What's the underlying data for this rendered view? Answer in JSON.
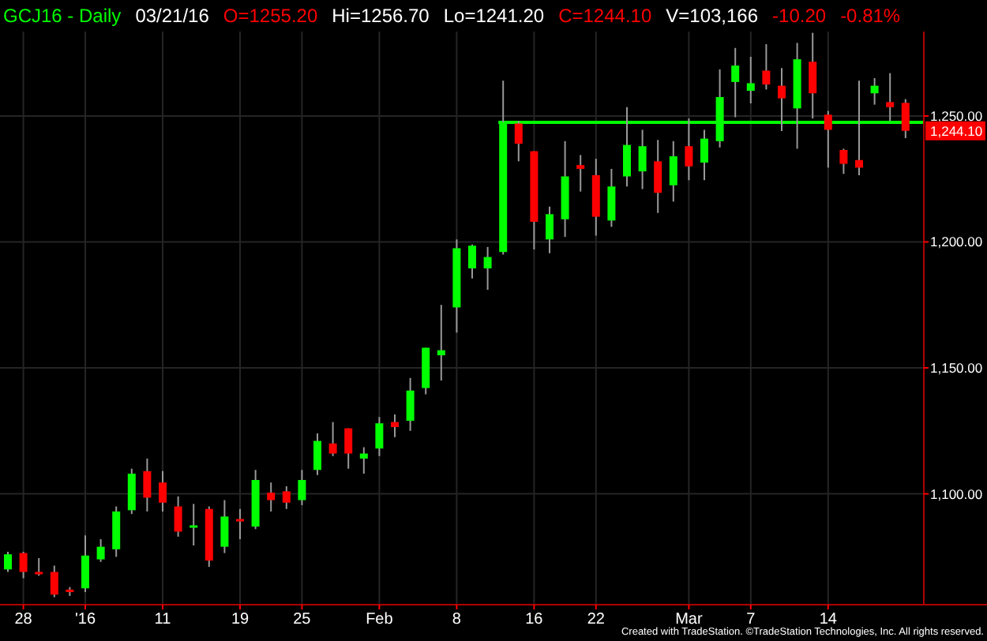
{
  "header": {
    "items": [
      {
        "text": "GCJ16 - Daily",
        "color": "#00ff00"
      },
      {
        "text": "03/21/16",
        "color": "#ffffff"
      },
      {
        "text": "O=1255.20",
        "color": "#ff0000"
      },
      {
        "text": "Hi=1256.70",
        "color": "#ffffff"
      },
      {
        "text": "Lo=1241.20",
        "color": "#ffffff"
      },
      {
        "text": "C=1244.10",
        "color": "#ff0000"
      },
      {
        "text": "V=103,166",
        "color": "#ffffff"
      },
      {
        "text": "-10.20",
        "color": "#ff0000"
      },
      {
        "text": "-0.81%",
        "color": "#ff0000"
      }
    ]
  },
  "chart": {
    "last_price": "1,244.10",
    "chart_data": {
      "type": "candlestick",
      "ylim": [
        1056,
        1283.5
      ],
      "grid": true,
      "yticks": [
        {
          "value": 1250,
          "label": "1,250.00"
        },
        {
          "value": 1200,
          "label": "1,200.00"
        },
        {
          "value": 1150,
          "label": "1,150.00"
        },
        {
          "value": 1100,
          "label": "1,100.00"
        }
      ],
      "categories": [
        null,
        "28",
        null,
        null,
        null,
        "'16",
        null,
        null,
        null,
        null,
        "11",
        null,
        null,
        null,
        null,
        "19",
        null,
        null,
        null,
        "25",
        null,
        null,
        null,
        null,
        "Feb",
        null,
        null,
        null,
        null,
        "8",
        null,
        null,
        null,
        null,
        "16",
        null,
        null,
        null,
        "22",
        null,
        null,
        null,
        null,
        null,
        "Mar",
        null,
        null,
        null,
        "7",
        null,
        null,
        null,
        null,
        "14",
        null,
        null,
        null,
        null,
        null
      ],
      "ohlc": [
        [
          1070,
          1077,
          1069,
          1076
        ],
        [
          1076.5,
          1077,
          1066.5,
          1069
        ],
        [
          1069,
          1074.5,
          1067.5,
          1068.5
        ],
        [
          1069,
          1071.5,
          1059,
          1060
        ],
        [
          1062,
          1063,
          1059.5,
          1061
        ],
        [
          1062.5,
          1083.5,
          1061,
          1075.5
        ],
        [
          1074,
          1082,
          1073,
          1079
        ],
        [
          1078,
          1095,
          1075,
          1093
        ],
        [
          1093.5,
          1110,
          1092,
          1108
        ],
        [
          1109,
          1114,
          1093,
          1098.5
        ],
        [
          1104.5,
          1109,
          1093,
          1096.5
        ],
        [
          1095,
          1099,
          1083,
          1085
        ],
        [
          1087,
          1096,
          1079.5,
          1087.5
        ],
        [
          1094,
          1095,
          1071,
          1073.5
        ],
        [
          1079,
          1097.5,
          1076.5,
          1091
        ],
        [
          1090,
          1094,
          1082,
          1089.5
        ],
        [
          1087,
          1109.5,
          1086,
          1105.5
        ],
        [
          1100.5,
          1104.5,
          1093,
          1097.5
        ],
        [
          1101,
          1103,
          1094,
          1096.5
        ],
        [
          1097.5,
          1109.5,
          1095.5,
          1105.5
        ],
        [
          1109.5,
          1124,
          1107.5,
          1121
        ],
        [
          1120,
          1128.5,
          1115,
          1116
        ],
        [
          1126,
          1126,
          1110,
          1116
        ],
        [
          1114,
          1118.5,
          1108,
          1116
        ],
        [
          1118,
          1130.5,
          1115,
          1128
        ],
        [
          1128.5,
          1131.5,
          1122.5,
          1126.5
        ],
        [
          1129,
          1146,
          1125,
          1141
        ],
        [
          1142,
          1158,
          1139.5,
          1158
        ],
        [
          1155,
          1175,
          1145,
          1157
        ],
        [
          1174,
          1201,
          1164,
          1197.5
        ],
        [
          1189.5,
          1199,
          1185.5,
          1198.5
        ],
        [
          1189.5,
          1198,
          1181,
          1194
        ],
        [
          1196,
          1264,
          1195,
          1247.5
        ],
        [
          1247,
          1248,
          1232,
          1239
        ],
        [
          1236,
          1236,
          1197,
          1208
        ],
        [
          1201,
          1214,
          1195.5,
          1211
        ],
        [
          1209,
          1240,
          1202,
          1226
        ],
        [
          1230.5,
          1234.5,
          1220,
          1229
        ],
        [
          1226.5,
          1233,
          1202.5,
          1210
        ],
        [
          1208.5,
          1229,
          1206,
          1222
        ],
        [
          1226,
          1253.5,
          1222,
          1238.5
        ],
        [
          1228,
          1244.5,
          1221,
          1238
        ],
        [
          1232,
          1240.5,
          1211.5,
          1219.5
        ],
        [
          1222.5,
          1240,
          1216,
          1234
        ],
        [
          1238,
          1249,
          1224.5,
          1230
        ],
        [
          1231.5,
          1244.5,
          1224.5,
          1241
        ],
        [
          1240,
          1268.5,
          1237.5,
          1257.5
        ],
        [
          1263.5,
          1277,
          1249.5,
          1270
        ],
        [
          1260,
          1273.5,
          1255,
          1263
        ],
        [
          1268,
          1278.5,
          1260.5,
          1262.5
        ],
        [
          1262,
          1269,
          1244,
          1257
        ],
        [
          1253,
          1279,
          1237,
          1272.5
        ],
        [
          1271.5,
          1283,
          1249,
          1259
        ],
        [
          1250.5,
          1252,
          1229.5,
          1244.5
        ],
        [
          1236.5,
          1237,
          1227,
          1231
        ],
        [
          1232.5,
          1264,
          1226.5,
          1229.5
        ],
        [
          1259,
          1265,
          1254.5,
          1262
        ],
        [
          1255.5,
          1267,
          1248,
          1253.5
        ],
        [
          1255.2,
          1256.7,
          1241.2,
          1244.1
        ]
      ]
    }
  },
  "footer": {
    "text": "Created with TradeStation. ©TradeStation Technologies, Inc. All rights reserved."
  }
}
